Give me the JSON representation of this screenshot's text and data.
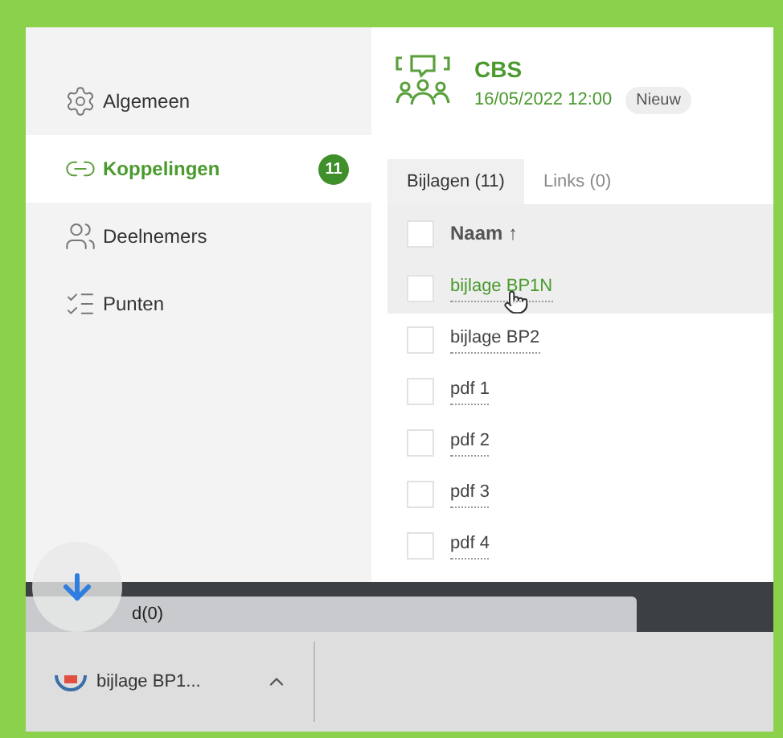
{
  "sidebar": {
    "items": [
      {
        "label": "Algemeen",
        "selected": false
      },
      {
        "label": "Koppelingen",
        "selected": true,
        "badge": "11"
      },
      {
        "label": "Deelnemers",
        "selected": false
      },
      {
        "label": "Punten",
        "selected": false
      }
    ]
  },
  "header": {
    "title": "CBS",
    "date": "16/05/2022 12:00",
    "status": "Nieuw"
  },
  "tabs": [
    {
      "label": "Bijlagen (11)",
      "selected": true
    },
    {
      "label": "Links (0)",
      "selected": false
    }
  ],
  "table": {
    "select_all_checked": false,
    "columns": [
      {
        "label": "Naam",
        "sort": "↑"
      }
    ],
    "rows": [
      {
        "name": "bijlage BP1N",
        "checked": false,
        "highlighted": true
      },
      {
        "name": "bijlage BP2",
        "checked": false,
        "highlighted": false
      },
      {
        "name": "pdf 1",
        "checked": false,
        "highlighted": false
      },
      {
        "name": "pdf 2",
        "checked": false,
        "highlighted": false
      },
      {
        "name": "pdf 3",
        "checked": false,
        "highlighted": false
      },
      {
        "name": "pdf 4",
        "checked": false,
        "highlighted": false
      }
    ]
  },
  "download_bar": {
    "tab_label": "d(0)"
  },
  "download_shelf": {
    "items": [
      {
        "name": "bijlage BP1..."
      }
    ]
  }
}
